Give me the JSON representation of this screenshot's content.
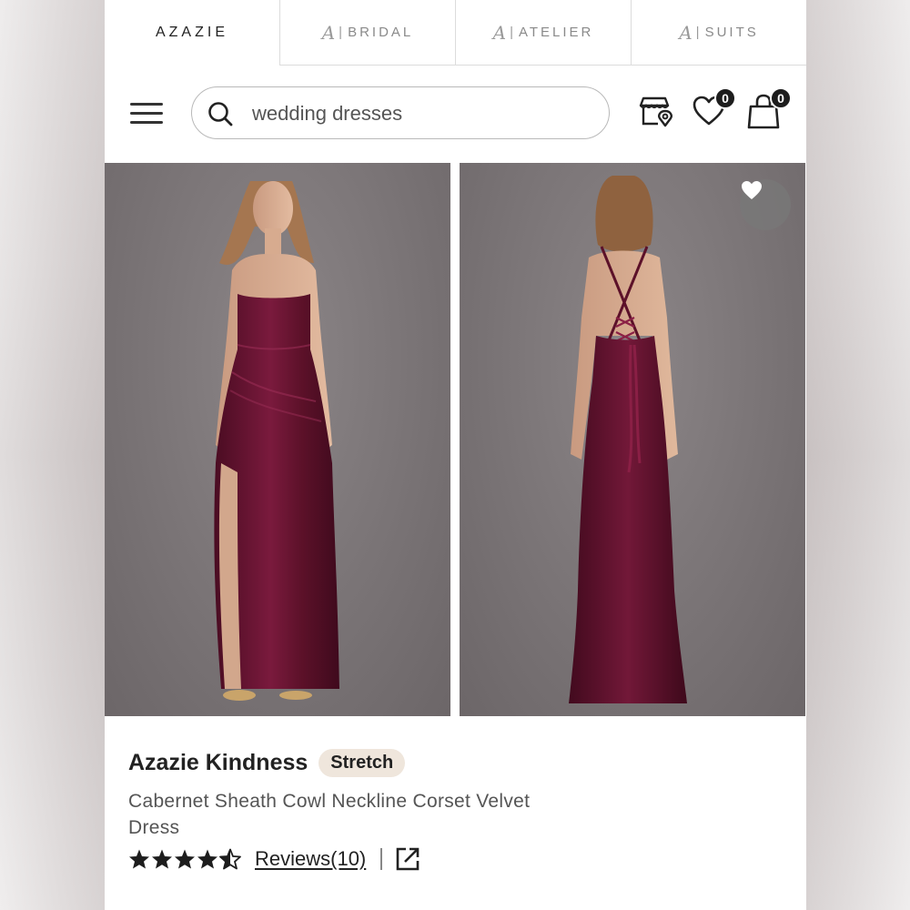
{
  "brand_tabs": [
    {
      "mark": "",
      "label": "AZAZIE",
      "active": true
    },
    {
      "mark": "A",
      "label": "BRIDAL",
      "active": false
    },
    {
      "mark": "A",
      "label": "ATELIER",
      "active": false
    },
    {
      "mark": "A",
      "label": "SUITS",
      "active": false
    }
  ],
  "search": {
    "value": "wedding dresses",
    "placeholder": "wedding dresses"
  },
  "header": {
    "wishlist_count": "0",
    "cart_count": "0"
  },
  "icons": [
    "menu-icon",
    "search-icon",
    "store-location-icon",
    "heart-icon",
    "shopping-bag-icon",
    "share-icon"
  ],
  "gallery": {
    "images": [
      "front-view",
      "back-view"
    ]
  },
  "product": {
    "brand": "Azazie Kindness",
    "badge": "Stretch",
    "name": "Cabernet Sheath Cowl Neckline Corset Velvet Dress",
    "rating": 4.5,
    "reviews_label": "Reviews(10)"
  },
  "colors": {
    "dress": "#6b1433",
    "badge_bg": "#efe6dc",
    "background": "#7a7476"
  }
}
